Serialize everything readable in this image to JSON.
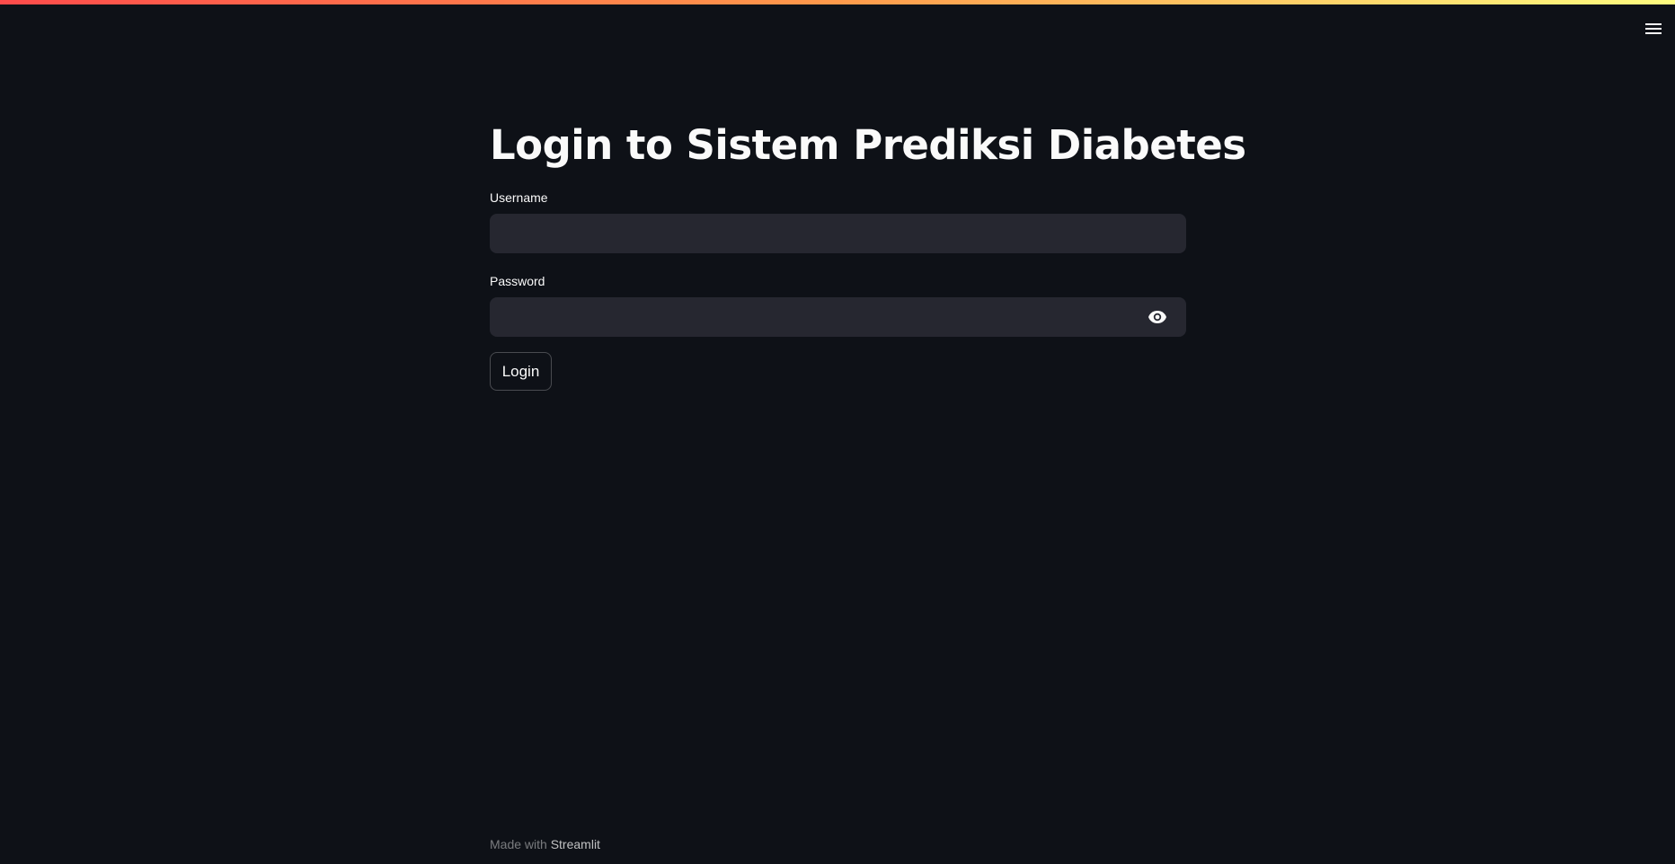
{
  "page": {
    "title": "Login to Sistem Prediksi Diabetes"
  },
  "form": {
    "username": {
      "label": "Username",
      "value": "",
      "placeholder": ""
    },
    "password": {
      "label": "Password",
      "value": "",
      "placeholder": ""
    },
    "login_button_label": "Login"
  },
  "footer": {
    "prefix": "Made with ",
    "link_text": "Streamlit"
  },
  "icons": {
    "menu": "hamburger-menu-icon",
    "password_toggle": "eye-icon"
  },
  "colors": {
    "background": "#0e1117",
    "input_background": "#262730",
    "text": "#fafafa",
    "accent_gradient_start": "#ff4b4b",
    "accent_gradient_end": "#fffd80"
  }
}
